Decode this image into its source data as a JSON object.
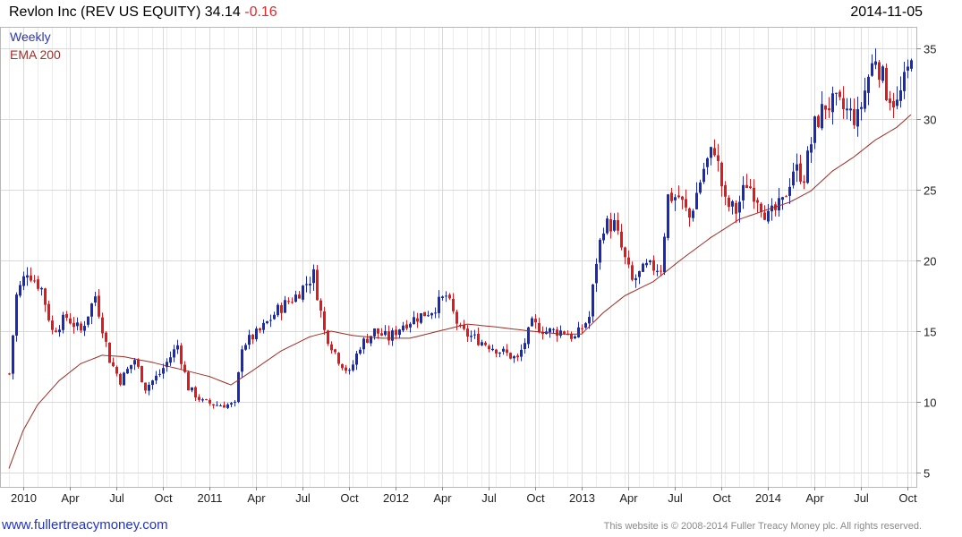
{
  "header": {
    "symbol": "Revlon Inc (REV US EQUITY)",
    "last": "34.14",
    "change": "-0.16",
    "date": "2014-11-05"
  },
  "legend": {
    "weekly": "Weekly",
    "ema": "EMA 200"
  },
  "footer": {
    "site": "www.fullertreacymoney.com",
    "copyright": "This website is © 2008-2014 Fuller Treacy Money plc. All rights reserved."
  },
  "colors": {
    "up": "#1b2ab5",
    "down": "#e0191f",
    "ema": "#a22a22",
    "grid": "#d9d9d9",
    "neutral": "#444444"
  },
  "chart_data": {
    "type": "candlestick",
    "timeframe": "weekly",
    "y_ticks": [
      5,
      10,
      15,
      20,
      25,
      30,
      35
    ],
    "ylim": [
      4,
      36.5
    ],
    "x_ticks": [
      {
        "label": "2010",
        "week": 4
      },
      {
        "label": "Apr",
        "week": 17
      },
      {
        "label": "Jul",
        "week": 30
      },
      {
        "label": "Oct",
        "week": 43
      },
      {
        "label": "2011",
        "week": 56
      },
      {
        "label": "Apr",
        "week": 69
      },
      {
        "label": "Jul",
        "week": 82
      },
      {
        "label": "Oct",
        "week": 95
      },
      {
        "label": "2012",
        "week": 108
      },
      {
        "label": "Apr",
        "week": 121
      },
      {
        "label": "Jul",
        "week": 134
      },
      {
        "label": "Oct",
        "week": 147
      },
      {
        "label": "2013",
        "week": 160
      },
      {
        "label": "Apr",
        "week": 173
      },
      {
        "label": "Jul",
        "week": 186
      },
      {
        "label": "Oct",
        "week": 199
      },
      {
        "label": "2014",
        "week": 212
      },
      {
        "label": "Apr",
        "week": 225
      },
      {
        "label": "Jul",
        "week": 238
      },
      {
        "label": "Oct",
        "week": 251
      }
    ],
    "close_path": [
      [
        0,
        12.0
      ],
      [
        2,
        17.5
      ],
      [
        5,
        19.3
      ],
      [
        9,
        18.0
      ],
      [
        12,
        15.0
      ],
      [
        16,
        16.0
      ],
      [
        20,
        15.0
      ],
      [
        24,
        17.5
      ],
      [
        28,
        13.0
      ],
      [
        31,
        11.5
      ],
      [
        35,
        13.0
      ],
      [
        38,
        11.0
      ],
      [
        42,
        12.0
      ],
      [
        47,
        14.0
      ],
      [
        50,
        11.0
      ],
      [
        54,
        10.0
      ],
      [
        58,
        9.8
      ],
      [
        63,
        9.8
      ],
      [
        65,
        14.0
      ],
      [
        70,
        15.0
      ],
      [
        75,
        16.5
      ],
      [
        80,
        17.5
      ],
      [
        85,
        19.0
      ],
      [
        88,
        15.0
      ],
      [
        92,
        13.0
      ],
      [
        95,
        12.0
      ],
      [
        98,
        14.0
      ],
      [
        102,
        15.0
      ],
      [
        106,
        14.5
      ],
      [
        110,
        15.5
      ],
      [
        114,
        16.0
      ],
      [
        118,
        16.5
      ],
      [
        122,
        17.5
      ],
      [
        126,
        15.0
      ],
      [
        130,
        14.5
      ],
      [
        134,
        14.0
      ],
      [
        138,
        13.5
      ],
      [
        142,
        13.0
      ],
      [
        146,
        15.5
      ],
      [
        150,
        15.0
      ],
      [
        155,
        15.0
      ],
      [
        158,
        14.5
      ],
      [
        162,
        16.0
      ],
      [
        164,
        20.0
      ],
      [
        166,
        22.5
      ],
      [
        169,
        22.5
      ],
      [
        172,
        20.0
      ],
      [
        174,
        18.5
      ],
      [
        178,
        19.5
      ],
      [
        182,
        19.5
      ],
      [
        184,
        24.5
      ],
      [
        187,
        24.5
      ],
      [
        190,
        23.0
      ],
      [
        194,
        26.5
      ],
      [
        197,
        28.0
      ],
      [
        200,
        24.0
      ],
      [
        203,
        23.5
      ],
      [
        206,
        25.5
      ],
      [
        209,
        24.5
      ],
      [
        212,
        23.0
      ],
      [
        216,
        24.0
      ],
      [
        219,
        26.5
      ],
      [
        222,
        26.0
      ],
      [
        225,
        29.5
      ],
      [
        228,
        31.0
      ],
      [
        231,
        31.0
      ],
      [
        234,
        30.5
      ],
      [
        237,
        30.0
      ],
      [
        240,
        33.0
      ],
      [
        242,
        34.5
      ],
      [
        245,
        32.0
      ],
      [
        248,
        31.0
      ],
      [
        250,
        32.5
      ],
      [
        252,
        34.14
      ]
    ],
    "ema_path": [
      [
        0,
        5.3
      ],
      [
        4,
        8.0
      ],
      [
        8,
        9.8
      ],
      [
        14,
        11.5
      ],
      [
        20,
        12.7
      ],
      [
        26,
        13.3
      ],
      [
        32,
        13.2
      ],
      [
        40,
        12.8
      ],
      [
        48,
        12.3
      ],
      [
        56,
        11.8
      ],
      [
        62,
        11.2
      ],
      [
        68,
        12.2
      ],
      [
        76,
        13.6
      ],
      [
        84,
        14.6
      ],
      [
        90,
        15.0
      ],
      [
        96,
        14.7
      ],
      [
        104,
        14.5
      ],
      [
        112,
        14.5
      ],
      [
        120,
        15.0
      ],
      [
        128,
        15.5
      ],
      [
        136,
        15.3
      ],
      [
        146,
        15.0
      ],
      [
        154,
        14.8
      ],
      [
        160,
        14.8
      ],
      [
        166,
        16.3
      ],
      [
        172,
        17.5
      ],
      [
        180,
        18.5
      ],
      [
        188,
        20.1
      ],
      [
        196,
        21.6
      ],
      [
        204,
        22.9
      ],
      [
        212,
        23.6
      ],
      [
        218,
        24.1
      ],
      [
        224,
        24.9
      ],
      [
        230,
        26.3
      ],
      [
        236,
        27.3
      ],
      [
        242,
        28.5
      ],
      [
        248,
        29.4
      ],
      [
        252,
        30.3
      ]
    ]
  }
}
